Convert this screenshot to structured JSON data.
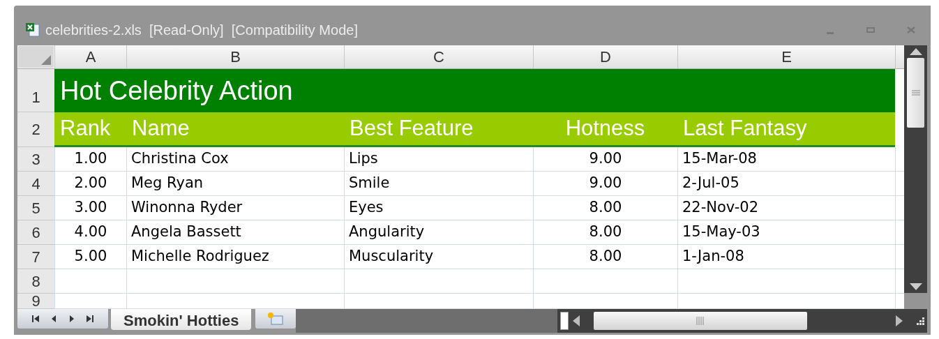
{
  "window": {
    "title": "celebrities-2.xls  [Read-Only]  [Compatibility Mode]"
  },
  "column_headers": [
    "A",
    "B",
    "C",
    "D",
    "E"
  ],
  "title_row": {
    "row_number": "1",
    "text": "Hot Celebrity Action"
  },
  "header_row": {
    "row_number": "2",
    "cells": [
      "Rank",
      "Name",
      "Best Feature",
      "Hotness",
      "Last Fantasy"
    ]
  },
  "rows": [
    {
      "row_number": "3",
      "cells": [
        "1.00",
        "Christina Cox",
        "Lips",
        "9.00",
        "15-Mar-08"
      ]
    },
    {
      "row_number": "4",
      "cells": [
        "2.00",
        "Meg Ryan",
        "Smile",
        "9.00",
        "2-Jul-05"
      ]
    },
    {
      "row_number": "5",
      "cells": [
        "3.00",
        "Winonna Ryder",
        "Eyes",
        "8.00",
        "22-Nov-02"
      ]
    },
    {
      "row_number": "6",
      "cells": [
        "4.00",
        "Angela Bassett",
        "Angularity",
        "8.00",
        "15-May-03"
      ]
    },
    {
      "row_number": "7",
      "cells": [
        "5.00",
        "Michelle Rodriguez",
        "Muscularity",
        "8.00",
        "1-Jan-08"
      ]
    },
    {
      "row_number": "8",
      "cells": [
        "",
        "",
        "",
        "",
        ""
      ]
    },
    {
      "row_number": "9",
      "cells": [
        "",
        "",
        "",
        "",
        ""
      ]
    }
  ],
  "sheet_tabs": [
    {
      "label": "Smokin' Hotties",
      "selected": true
    }
  ]
}
